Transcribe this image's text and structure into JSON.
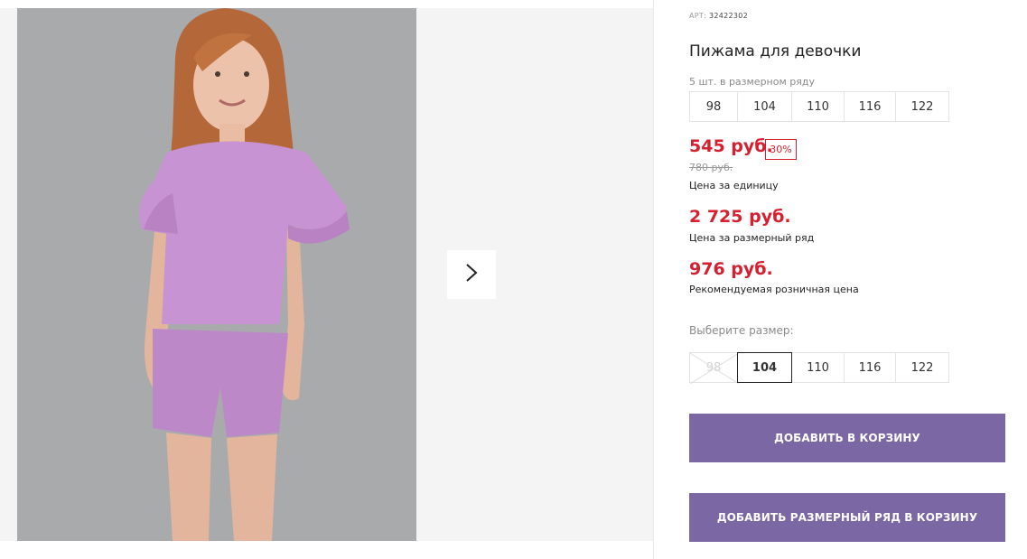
{
  "product": {
    "article_label": "АРТ:",
    "article_number": "32422302",
    "title": "Пижама для девочки"
  },
  "pack": {
    "note": "5 шт. в размерном ряду",
    "sizes": [
      "98",
      "104",
      "110",
      "116",
      "122"
    ]
  },
  "pricing": {
    "unit_price": "545 руб.",
    "discount": "30%",
    "old_price": "780 руб.",
    "unit_price_label": "Цена за единицу",
    "pack_price": "2 725 руб.",
    "pack_price_label": "Цена за размерный ряд",
    "retail_price": "976 руб.",
    "retail_price_label": "Рекомендуемая розничная цена"
  },
  "size_picker": {
    "label": "Выберите размер:",
    "options": [
      "98",
      "104",
      "110",
      "116",
      "122"
    ],
    "selected": "104",
    "unavailable": [
      "98"
    ]
  },
  "actions": {
    "add_to_cart": "Добавить в корзину",
    "add_pack_to_cart": "Добавить размерный ряд в корзину"
  },
  "colors": {
    "accent_price": "#d62030",
    "button": "#7a67a3",
    "garment": "#c48fcf"
  },
  "icons": {
    "gallery_next": "chevron-right-icon"
  }
}
